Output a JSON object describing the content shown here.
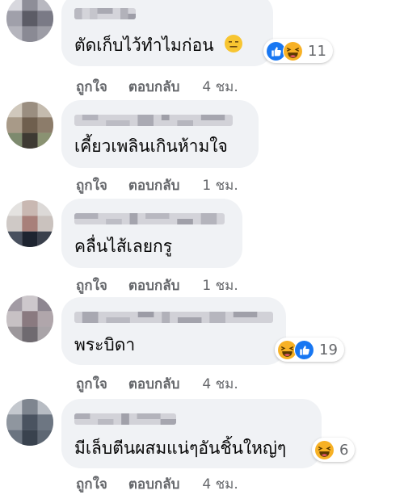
{
  "colors": {
    "bubble": "#f0f2f5",
    "meta_text": "#65676b",
    "like_blue": "#1877f2",
    "haha_yellow": "#f7b125"
  },
  "actions": {
    "like_label": "ถูกใจ",
    "reply_label": "ตอบกลับ"
  },
  "comments": [
    {
      "text": "ตัดเก็บไว้ทำไมก่อน",
      "inline_emoji": "expressionless-face-icon",
      "reactions": [
        "like-icon",
        "haha-icon"
      ],
      "reaction_count": "11",
      "time": "4 ชม."
    },
    {
      "text": "เคี้ยวเพลินเกินห้ามใจ",
      "time": "1 ชม."
    },
    {
      "text": "คลื่นไส้เลยกรู",
      "time": "1 ชม."
    },
    {
      "text": "พระบิดา",
      "reactions": [
        "haha-icon",
        "like-icon"
      ],
      "reaction_count": "19",
      "time": "4 ชม."
    },
    {
      "text": "มีเล็บตีนผสมแน่ๆอันชิ้นใหญ่ๆ",
      "reactions": [
        "haha-icon"
      ],
      "reaction_count": "6",
      "time": "4 ชม."
    }
  ]
}
